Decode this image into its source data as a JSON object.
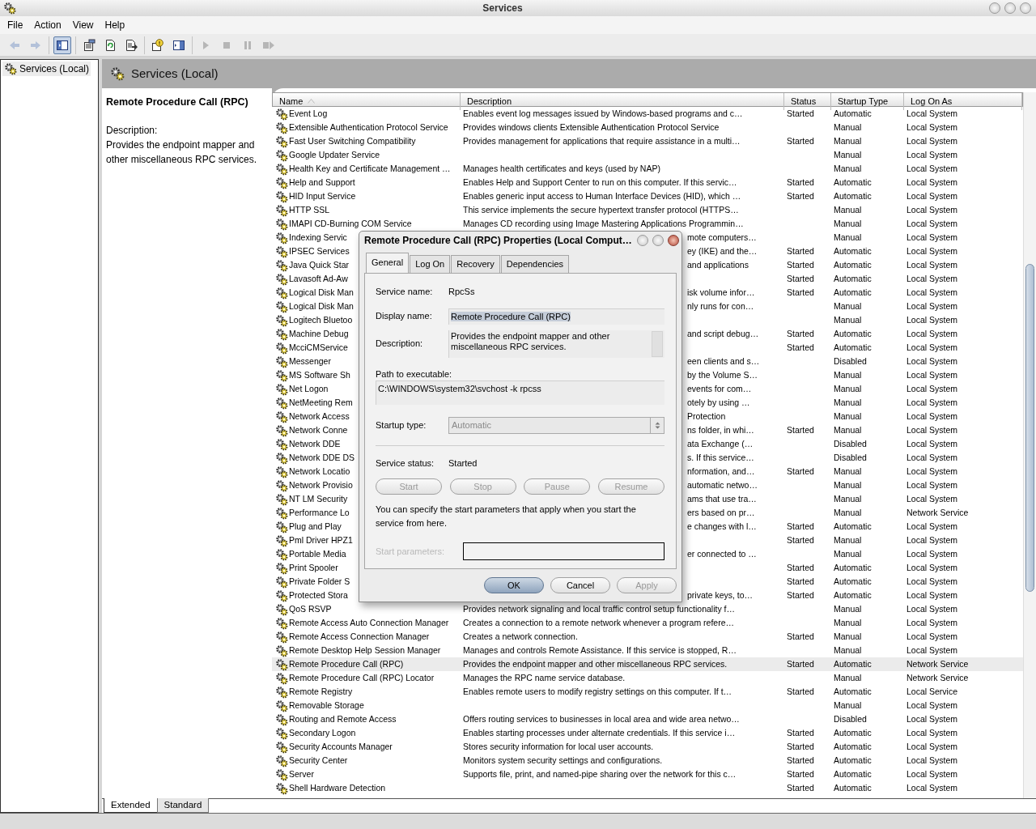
{
  "window": {
    "title": "Services"
  },
  "menu": [
    "File",
    "Action",
    "View",
    "Help"
  ],
  "toolbar": [
    [
      {
        "kind": "back",
        "disabled": true,
        "pressed": false
      },
      {
        "kind": "forward",
        "disabled": true,
        "pressed": false
      }
    ],
    [
      {
        "kind": "tree",
        "disabled": false,
        "pressed": true
      }
    ],
    [
      {
        "kind": "properties",
        "disabled": false,
        "pressed": false
      },
      {
        "kind": "refresh",
        "disabled": false,
        "pressed": false
      },
      {
        "kind": "export",
        "disabled": false,
        "pressed": false
      }
    ],
    [
      {
        "kind": "help",
        "disabled": false,
        "pressed": false
      },
      {
        "kind": "action-pane",
        "disabled": false,
        "pressed": false
      }
    ],
    [
      {
        "kind": "start",
        "disabled": true,
        "pressed": false
      },
      {
        "kind": "stop",
        "disabled": true,
        "pressed": false
      },
      {
        "kind": "pause",
        "disabled": true,
        "pressed": false
      },
      {
        "kind": "restart",
        "disabled": true,
        "pressed": false
      }
    ]
  ],
  "tree": [
    {
      "label": "Services (Local)",
      "selected": true
    }
  ],
  "pane": {
    "title": "Services (Local)"
  },
  "details": {
    "title": "Remote Procedure Call (RPC)",
    "description_label": "Description:",
    "description": "Provides the endpoint mapper and other miscellaneous RPC services."
  },
  "table": {
    "columns": [
      {
        "label": "Name",
        "sorted": true
      },
      {
        "label": "Description",
        "sorted": false
      },
      {
        "label": "Status",
        "sorted": false
      },
      {
        "label": "Startup Type",
        "sorted": false
      },
      {
        "label": "Log On As",
        "sorted": false
      }
    ],
    "rows": [
      {
        "name": "Event Log",
        "description": "Enables event log messages issued by Windows-based programs and c…",
        "status": "Started",
        "startup_type": "Automatic",
        "log_on_as": "Local System",
        "selected": false
      },
      {
        "name": "Extensible Authentication Protocol Service",
        "description": "Provides windows clients Extensible Authentication Protocol Service",
        "startup_type": "Manual",
        "log_on_as": "Local System",
        "selected": false
      },
      {
        "name": "Fast User Switching Compatibility",
        "description": "Provides management for applications that require assistance in a multi…",
        "status": "Started",
        "startup_type": "Manual",
        "log_on_as": "Local System",
        "selected": false
      },
      {
        "name": "Google Updater Service",
        "startup_type": "Manual",
        "log_on_as": "Local System",
        "selected": false
      },
      {
        "name": "Health Key and Certificate Management …",
        "description": "Manages health certificates and keys (used by NAP)",
        "startup_type": "Manual",
        "log_on_as": "Local System",
        "selected": false
      },
      {
        "name": "Help and Support",
        "description": "Enables Help and Support Center to run on this computer. If this servic…",
        "status": "Started",
        "startup_type": "Automatic",
        "log_on_as": "Local System",
        "selected": false
      },
      {
        "name": "HID Input Service",
        "description": "Enables generic input access to Human Interface Devices (HID), which …",
        "status": "Started",
        "startup_type": "Automatic",
        "log_on_as": "Local System",
        "selected": false
      },
      {
        "name": "HTTP SSL",
        "description": "This service implements the secure hypertext transfer protocol (HTTPS…",
        "startup_type": "Manual",
        "log_on_as": "Local System",
        "selected": false
      },
      {
        "name": "IMAPI CD-Burning COM Service",
        "description": "Manages CD recording using Image Mastering Applications Programmin…",
        "startup_type": "Manual",
        "log_on_as": "Local System",
        "selected": false
      },
      {
        "name": "Indexing Servic",
        "description": "mote computers…",
        "startup_type": "Manual",
        "log_on_as": "Local System",
        "selected": false
      },
      {
        "name": "IPSEC Services",
        "description": "ey (IKE) and the…",
        "status": "Started",
        "startup_type": "Automatic",
        "log_on_as": "Local System",
        "selected": false
      },
      {
        "name": "Java Quick Star",
        "description": "and applications",
        "status": "Started",
        "startup_type": "Automatic",
        "log_on_as": "Local System",
        "selected": false
      },
      {
        "name": "Lavasoft Ad-Aw",
        "status": "Started",
        "startup_type": "Automatic",
        "log_on_as": "Local System",
        "selected": false
      },
      {
        "name": "Logical Disk Man",
        "description": "isk volume infor…",
        "status": "Started",
        "startup_type": "Automatic",
        "log_on_as": "Local System",
        "selected": false
      },
      {
        "name": "Logical Disk Man",
        "description": "nly runs for con…",
        "startup_type": "Manual",
        "log_on_as": "Local System",
        "selected": false
      },
      {
        "name": "Logitech Bluetoo",
        "startup_type": "Manual",
        "log_on_as": "Local System",
        "selected": false
      },
      {
        "name": "Machine Debug",
        "description": "and script debug…",
        "status": "Started",
        "startup_type": "Automatic",
        "log_on_as": "Local System",
        "selected": false
      },
      {
        "name": "McciCMService",
        "status": "Started",
        "startup_type": "Automatic",
        "log_on_as": "Local System",
        "selected": false
      },
      {
        "name": "Messenger",
        "description": "een clients and s…",
        "startup_type": "Disabled",
        "log_on_as": "Local System",
        "selected": false
      },
      {
        "name": "MS Software Sh",
        "description": "by the Volume S…",
        "startup_type": "Manual",
        "log_on_as": "Local System",
        "selected": false
      },
      {
        "name": "Net Logon",
        "description": "events for com…",
        "startup_type": "Manual",
        "log_on_as": "Local System",
        "selected": false
      },
      {
        "name": "NetMeeting Rem",
        "description": "otely by using …",
        "startup_type": "Manual",
        "log_on_as": "Local System",
        "selected": false
      },
      {
        "name": "Network Access",
        "description": "Protection",
        "startup_type": "Manual",
        "log_on_as": "Local System",
        "selected": false
      },
      {
        "name": "Network Conne",
        "description": "ns folder, in whi…",
        "status": "Started",
        "startup_type": "Manual",
        "log_on_as": "Local System",
        "selected": false
      },
      {
        "name": "Network DDE",
        "description": "ata Exchange (…",
        "startup_type": "Disabled",
        "log_on_as": "Local System",
        "selected": false
      },
      {
        "name": "Network DDE DS",
        "description": "s. If this service…",
        "startup_type": "Disabled",
        "log_on_as": "Local System",
        "selected": false
      },
      {
        "name": "Network Locatio",
        "description": "nformation, and…",
        "status": "Started",
        "startup_type": "Manual",
        "log_on_as": "Local System",
        "selected": false
      },
      {
        "name": "Network Provisio",
        "description": "automatic netwo…",
        "startup_type": "Manual",
        "log_on_as": "Local System",
        "selected": false
      },
      {
        "name": "NT LM Security",
        "description": "ams that use tra…",
        "startup_type": "Manual",
        "log_on_as": "Local System",
        "selected": false
      },
      {
        "name": "Performance Lo",
        "description": "ers based on pr…",
        "startup_type": "Manual",
        "log_on_as": "Network Service",
        "selected": false
      },
      {
        "name": "Plug and Play",
        "description": "e changes with l…",
        "status": "Started",
        "startup_type": "Automatic",
        "log_on_as": "Local System",
        "selected": false
      },
      {
        "name": "Pml Driver HPZ1",
        "status": "Started",
        "startup_type": "Manual",
        "log_on_as": "Local System",
        "selected": false
      },
      {
        "name": "Portable Media",
        "description": "er connected to …",
        "startup_type": "Manual",
        "log_on_as": "Local System",
        "selected": false
      },
      {
        "name": "Print Spooler",
        "status": "Started",
        "startup_type": "Automatic",
        "log_on_as": "Local System",
        "selected": false
      },
      {
        "name": "Private Folder S",
        "status": "Started",
        "startup_type": "Automatic",
        "log_on_as": "Local System",
        "selected": false
      },
      {
        "name": "Protected Stora",
        "description": "private keys, to…",
        "status": "Started",
        "startup_type": "Automatic",
        "log_on_as": "Local System",
        "selected": false
      },
      {
        "name": "QoS RSVP",
        "description": "Provides network signaling and local traffic control setup functionality f…",
        "startup_type": "Manual",
        "log_on_as": "Local System",
        "selected": false
      },
      {
        "name": "Remote Access Auto Connection Manager",
        "description": "Creates a connection to a remote network whenever a program refere…",
        "startup_type": "Manual",
        "log_on_as": "Local System",
        "selected": false
      },
      {
        "name": "Remote Access Connection Manager",
        "description": "Creates a network connection.",
        "status": "Started",
        "startup_type": "Manual",
        "log_on_as": "Local System",
        "selected": false
      },
      {
        "name": "Remote Desktop Help Session Manager",
        "description": "Manages and controls Remote Assistance. If this service is stopped, R…",
        "startup_type": "Manual",
        "log_on_as": "Local System",
        "selected": false
      },
      {
        "name": "Remote Procedure Call (RPC)",
        "description": "Provides the endpoint mapper and other miscellaneous RPC services.",
        "status": "Started",
        "startup_type": "Automatic",
        "log_on_as": "Network Service",
        "selected": true
      },
      {
        "name": "Remote Procedure Call (RPC) Locator",
        "description": "Manages the RPC name service database.",
        "startup_type": "Manual",
        "log_on_as": "Network Service",
        "selected": false
      },
      {
        "name": "Remote Registry",
        "description": "Enables remote users to modify registry settings on this computer. If t…",
        "status": "Started",
        "startup_type": "Automatic",
        "log_on_as": "Local Service",
        "selected": false
      },
      {
        "name": "Removable Storage",
        "startup_type": "Manual",
        "log_on_as": "Local System",
        "selected": false
      },
      {
        "name": "Routing and Remote Access",
        "description": "Offers routing services to businesses in local area and wide area netwo…",
        "startup_type": "Disabled",
        "log_on_as": "Local System",
        "selected": false
      },
      {
        "name": "Secondary Logon",
        "description": "Enables starting processes under alternate credentials. If this service i…",
        "status": "Started",
        "startup_type": "Automatic",
        "log_on_as": "Local System",
        "selected": false
      },
      {
        "name": "Security Accounts Manager",
        "description": "Stores security information for local user accounts.",
        "status": "Started",
        "startup_type": "Automatic",
        "log_on_as": "Local System",
        "selected": false
      },
      {
        "name": "Security Center",
        "description": "Monitors system security settings and configurations.",
        "status": "Started",
        "startup_type": "Automatic",
        "log_on_as": "Local System",
        "selected": false
      },
      {
        "name": "Server",
        "description": "Supports file, print, and named-pipe sharing over the network for this c…",
        "status": "Started",
        "startup_type": "Automatic",
        "log_on_as": "Local System",
        "selected": false
      },
      {
        "name": "Shell Hardware Detection",
        "status": "Started",
        "startup_type": "Automatic",
        "log_on_as": "Local System",
        "selected": false
      }
    ]
  },
  "view_tabs": [
    {
      "label": "Extended",
      "selected": true
    },
    {
      "label": "Standard",
      "selected": false
    }
  ],
  "dialog": {
    "title": "Remote Procedure Call (RPC) Properties (Local Comput…",
    "tabs": [
      {
        "label": "General",
        "selected": true
      },
      {
        "label": "Log On",
        "selected": false
      },
      {
        "label": "Recovery",
        "selected": false
      },
      {
        "label": "Dependencies",
        "selected": false
      }
    ],
    "service_name_label": "Service name:",
    "service_name": "RpcSs",
    "display_name_label": "Display name:",
    "display_name": "Remote Procedure Call (RPC)",
    "display_name_highlighted": true,
    "description_label": "Description:",
    "description": "Provides the endpoint mapper and other miscellaneous RPC services.",
    "path_label": "Path to executable:",
    "path": "C:\\WINDOWS\\system32\\svchost -k rpcss",
    "startup_label": "Startup type:",
    "startup_type": {
      "value": "Automatic",
      "disabled": true
    },
    "status_label": "Service status:",
    "status": "Started",
    "control_buttons": [
      {
        "label": "Start",
        "disabled": true
      },
      {
        "label": "Stop",
        "disabled": true
      },
      {
        "label": "Pause",
        "disabled": true
      },
      {
        "label": "Resume",
        "disabled": true
      }
    ],
    "hint": "You can specify the start parameters that apply when you start the service from here.",
    "parameters": {
      "label": "Start parameters:",
      "disabled": true
    },
    "buttons": [
      {
        "label": "OK",
        "default": true,
        "disabled": false
      },
      {
        "label": "Cancel",
        "default": false,
        "disabled": false
      },
      {
        "label": "Apply",
        "default": false,
        "disabled": true
      }
    ]
  }
}
